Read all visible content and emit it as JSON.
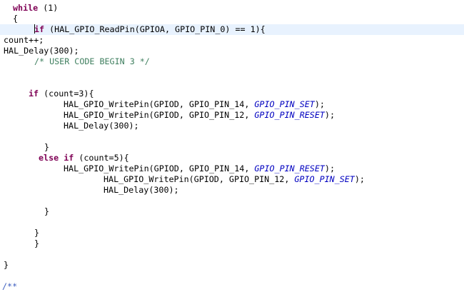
{
  "editor": {
    "lines": [
      {
        "id": "l1",
        "indent": 18,
        "tokens": [
          {
            "t": "kw",
            "v": "while"
          },
          {
            "t": "p",
            "v": " (1)"
          }
        ]
      },
      {
        "id": "l2",
        "indent": 18,
        "tokens": [
          {
            "t": "p",
            "v": "{"
          }
        ]
      },
      {
        "id": "l3",
        "indent": 48,
        "tokens": [
          {
            "t": "caret",
            "v": ""
          },
          {
            "t": "kw",
            "v": "if"
          },
          {
            "t": "p",
            "v": " (HAL_GPIO_ReadPin(GPIOA, GPIO_PIN_0) == 1){"
          }
        ]
      },
      {
        "id": "l4",
        "indent": 5,
        "tokens": [
          {
            "t": "p",
            "v": "count++;"
          }
        ]
      },
      {
        "id": "l5",
        "indent": 5,
        "tokens": [
          {
            "t": "p",
            "v": "HAL_Delay(300);"
          }
        ]
      },
      {
        "id": "l6",
        "indent": 48,
        "tokens": [
          {
            "t": "comment",
            "v": "/* USER CODE BEGIN 3 */"
          }
        ]
      },
      {
        "id": "l7",
        "indent": 0,
        "tokens": []
      },
      {
        "id": "l8",
        "indent": 0,
        "tokens": []
      },
      {
        "id": "l9",
        "indent": 40,
        "tokens": [
          {
            "t": "kw",
            "v": "if"
          },
          {
            "t": "p",
            "v": " (count=3){"
          }
        ]
      },
      {
        "id": "l10",
        "indent": 89,
        "tokens": [
          {
            "t": "p",
            "v": "HAL_GPIO_WritePin(GPIOD, GPIO_PIN_14, "
          },
          {
            "t": "const",
            "v": "GPIO_PIN_SET"
          },
          {
            "t": "p",
            "v": ");"
          }
        ]
      },
      {
        "id": "l11",
        "indent": 89,
        "tokens": [
          {
            "t": "p",
            "v": "HAL_GPIO_WritePin(GPIOD, GPIO_PIN_12, "
          },
          {
            "t": "const",
            "v": "GPIO_PIN_RESET"
          },
          {
            "t": "p",
            "v": ");"
          }
        ]
      },
      {
        "id": "l12",
        "indent": 89,
        "tokens": [
          {
            "t": "p",
            "v": "HAL_Delay(300);"
          }
        ]
      },
      {
        "id": "l13",
        "indent": 0,
        "tokens": []
      },
      {
        "id": "l14",
        "indent": 62,
        "tokens": [
          {
            "t": "p",
            "v": "}"
          }
        ]
      },
      {
        "id": "l15",
        "indent": 54,
        "tokens": [
          {
            "t": "kw",
            "v": "else"
          },
          {
            "t": "p",
            "v": " "
          },
          {
            "t": "kw",
            "v": "if"
          },
          {
            "t": "p",
            "v": " (count=5){"
          }
        ]
      },
      {
        "id": "l16",
        "indent": 89,
        "tokens": [
          {
            "t": "p",
            "v": "HAL_GPIO_WritePin(GPIOD, GPIO_PIN_14, "
          },
          {
            "t": "const",
            "v": "GPIO_PIN_RESET"
          },
          {
            "t": "p",
            "v": ");"
          }
        ]
      },
      {
        "id": "l17",
        "indent": 145,
        "tokens": [
          {
            "t": "p",
            "v": "HAL_GPIO_WritePin(GPIOD, GPIO_PIN_12, "
          },
          {
            "t": "const",
            "v": "GPIO_PIN_SET"
          },
          {
            "t": "p",
            "v": ");"
          }
        ]
      },
      {
        "id": "l18",
        "indent": 145,
        "tokens": [
          {
            "t": "p",
            "v": "HAL_Delay(300);"
          }
        ]
      },
      {
        "id": "l19",
        "indent": 0,
        "tokens": []
      },
      {
        "id": "l20",
        "indent": 62,
        "tokens": [
          {
            "t": "p",
            "v": "}"
          }
        ]
      },
      {
        "id": "l21",
        "indent": 0,
        "tokens": []
      },
      {
        "id": "l22",
        "indent": 48,
        "tokens": [
          {
            "t": "p",
            "v": "}"
          }
        ]
      },
      {
        "id": "l23",
        "indent": 48,
        "tokens": [
          {
            "t": "p",
            "v": "}"
          }
        ]
      },
      {
        "id": "l24",
        "indent": 0,
        "tokens": []
      },
      {
        "id": "l25",
        "indent": 5,
        "tokens": [
          {
            "t": "p",
            "v": "}"
          }
        ]
      },
      {
        "id": "l26",
        "indent": 0,
        "tokens": []
      },
      {
        "id": "l27",
        "indent": 3,
        "tokens": [
          {
            "t": "javadoc",
            "v": "/**"
          }
        ]
      }
    ]
  }
}
